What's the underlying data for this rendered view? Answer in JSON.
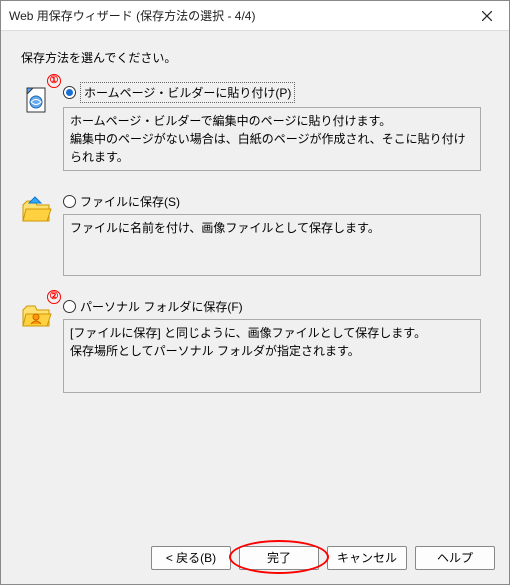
{
  "titlebar": {
    "title": "Web 用保存ウィザード (保存方法の選択 - 4/4)"
  },
  "content": {
    "instruction": "保存方法を選んでください。"
  },
  "options": {
    "opt1": {
      "badge": "①",
      "label": "ホームページ・ビルダーに貼り付け(P)",
      "desc1": "ホームページ・ビルダーで編集中のページに貼り付けます。",
      "desc2": "編集中のページがない場合は、白紙のページが作成され、そこに貼り付けられます。"
    },
    "opt2": {
      "label": "ファイルに保存(S)",
      "desc1": "ファイルに名前を付け、画像ファイルとして保存します。"
    },
    "opt3": {
      "badge": "②",
      "label": "パーソナル フォルダに保存(F)",
      "desc1": "[ファイルに保存] と同じように、画像ファイルとして保存します。",
      "desc2": "保存場所としてパーソナル フォルダが指定されます。"
    }
  },
  "footer": {
    "back": "< 戻る(B)",
    "finish": "完了",
    "cancel": "キャンセル",
    "help": "ヘルプ"
  }
}
